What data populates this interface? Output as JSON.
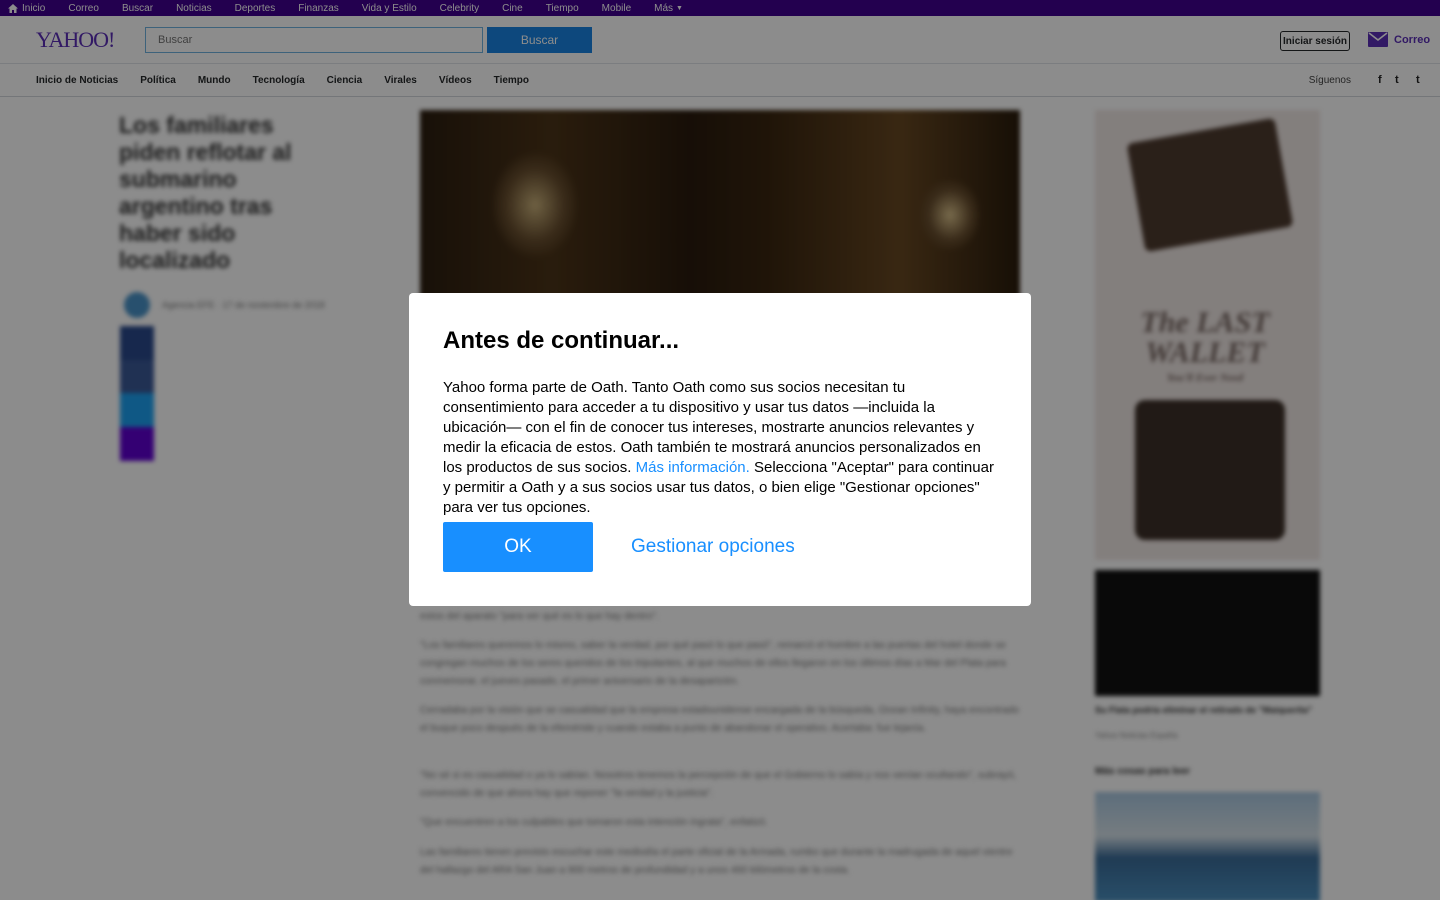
{
  "topbar": {
    "items": [
      "Inicio",
      "Correo",
      "Buscar",
      "Noticias",
      "Deportes",
      "Finanzas",
      "Vida y Estilo",
      "Celebrity",
      "Cine",
      "Tiempo",
      "Mobile",
      "Más"
    ]
  },
  "header": {
    "logo": "YAHOO!",
    "search_placeholder": "Buscar",
    "search_button": "Buscar",
    "signin": "Iniciar sesión",
    "mail": "Correo"
  },
  "newsnav": {
    "items": [
      "Inicio de Noticias",
      "Política",
      "Mundo",
      "Tecnología",
      "Ciencia",
      "Virales",
      "Vídeos",
      "Tiempo"
    ],
    "follow": "Síguenos",
    "social": [
      "f",
      "t",
      "t"
    ]
  },
  "article": {
    "title": "Los familiares piden reflotar al submarino argentino tras haber sido localizado",
    "author": "Agencia EFE · 17 de noviembre de 2018",
    "paragraphs": [
      "estos del aparato \"para ver qué es lo que hay dentro\".",
      "\"Los familiares queremos lo mismo, saber la verdad, por qué pasó lo que pasó\", remarcó el hombre a las puertas del hotel donde se congregan muchos de los seres queridos de los tripulantes, al que muchos de ellos llegaron en los últimos días a Mar del Plata para conmemorar, el jueves pasado, el primer aniversario de la desaparición.",
      "Cerradaba por la visión que se casualidad que la empresa estadounidense encargada de la búsqueda, Ocean Infinity, haya encontrado el buque poco después de la efeméride y cuando estaba a punto de abandonar el operativo. Acertaba: fue lejanía.",
      "\"No sé si es casualidad o ya lo sabían. Nosotros tenemos la percepción de que el Gobierno lo sabía y nos venían ocultando\", subrayó, convencido de que ahora hay que reponer \"la verdad y la justicia\".",
      "\"Que encuentren a los culpables que tomaron esta intención ingrata\", enfatizó.",
      "Las familiares tienen previsto escuchar este mediodía el parte oficial de la Armada, rumbo que durante la madrugada de aquel vientre del hallazgo del ARA San Juan a 900 metros de profundidad y a unos 460 kilómetros de la costa."
    ]
  },
  "rail": {
    "ad_text": "The LAST WALLET",
    "ad_sub": "You'll Ever Need",
    "video_caption": "Su Flata podría eliminar el retirado de \"Maiquerita\"",
    "video_source": "Yahoo Noticias España",
    "more_title": "Más cosas para leer"
  },
  "modal": {
    "title": "Antes de continuar...",
    "message_before": "Yahoo forma parte de Oath. Tanto Oath como sus socios necesitan tu consentimiento para acceder a tu dispositivo y usar tus datos —incluida la ubicación— con el fin de conocer tus intereses, mostrarte anuncios relevantes y medir la eficacia de estos. Oath también te mostrará anuncios personalizados en los productos de sus socios.",
    "link": "Más información.",
    "message_after": " Selecciona \"Aceptar\" para continuar y permitir a Oath y a sus socios usar tus datos, o bien elige \"Gestionar opciones\" para ver tus opciones.",
    "ok": "OK",
    "manage": "Gestionar opciones"
  },
  "colors": {
    "brand_purple": "#400090",
    "accent_blue": "#188fff",
    "search_blue": "#1884e3"
  }
}
